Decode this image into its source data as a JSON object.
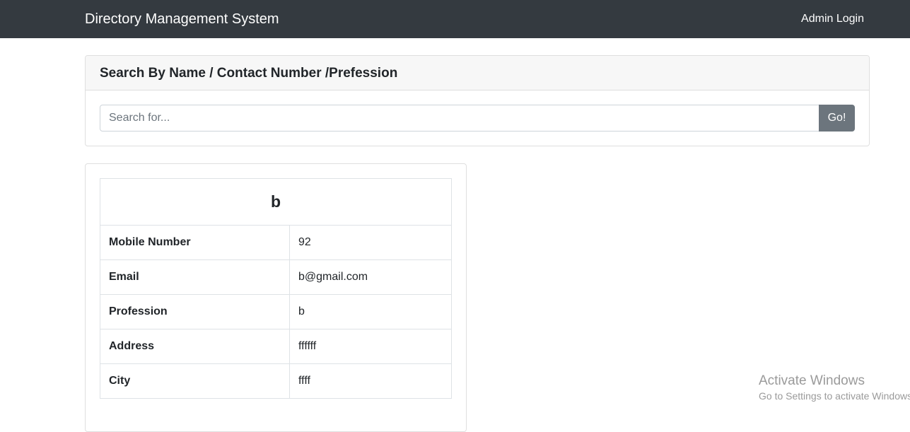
{
  "navbar": {
    "brand": "Directory Management System",
    "admin_login": "Admin Login"
  },
  "search": {
    "header": "Search By Name / Contact Number /Prefession",
    "placeholder": "Search for...",
    "value": "",
    "button_label": "Go!"
  },
  "result": {
    "name": "b",
    "rows": [
      {
        "label": "Mobile Number",
        "value": "92"
      },
      {
        "label": "Email",
        "value": "b@gmail.com"
      },
      {
        "label": "Profession",
        "value": "b"
      },
      {
        "label": "Address",
        "value": "ffffff"
      },
      {
        "label": "City",
        "value": "ffff"
      }
    ]
  },
  "watermark": {
    "title": "Activate Windows",
    "subtitle": "Go to Settings to activate Windows."
  },
  "colors": {
    "navbar_bg": "#343a40",
    "button_bg": "#6c757d",
    "card_header_bg": "#f7f7f7"
  }
}
